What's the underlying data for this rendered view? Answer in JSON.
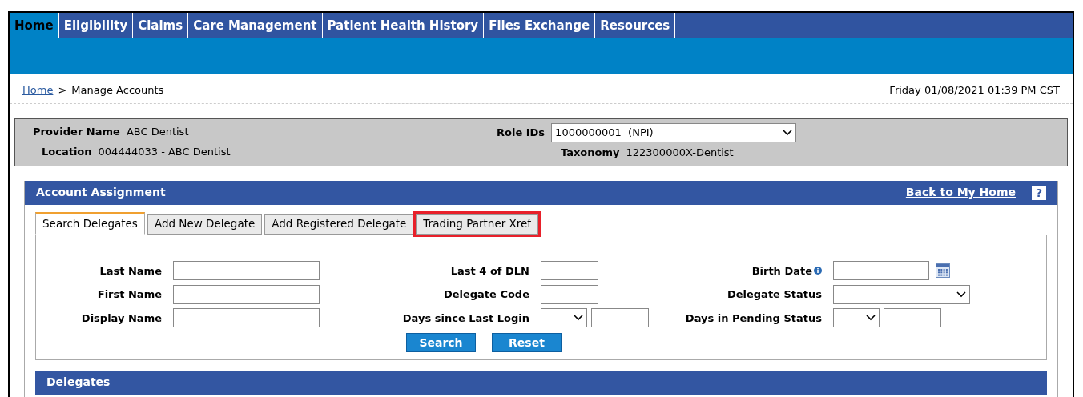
{
  "nav": [
    {
      "label": "Home",
      "selected": true
    },
    {
      "label": "Eligibility",
      "selected": false
    },
    {
      "label": "Claims",
      "selected": false
    },
    {
      "label": "Care Management",
      "selected": false
    },
    {
      "label": "Patient Health History",
      "selected": false
    },
    {
      "label": "Files Exchange",
      "selected": false
    },
    {
      "label": "Resources",
      "selected": false
    }
  ],
  "breadcrumb": {
    "link": "Home",
    "separator": ">",
    "current": "Manage Accounts"
  },
  "datetime": "Friday 01/08/2021 01:39 PM CST",
  "provider": {
    "name_label": "Provider Name",
    "name": "ABC Dentist",
    "location_label": "Location",
    "location": "004444033 - ABC Dentist",
    "role_label": "Role IDs",
    "role_value": "1000000001  (NPI)",
    "taxonomy_label": "Taxonomy",
    "taxonomy": "122300000X-Dentist"
  },
  "panel": {
    "title": "Account Assignment",
    "back_link": "Back to My Home",
    "help": "?",
    "tabs": [
      {
        "label": "Search Delegates",
        "selected": true,
        "highlighted": false
      },
      {
        "label": "Add New Delegate",
        "selected": false,
        "highlighted": false
      },
      {
        "label": "Add Registered Delegate",
        "selected": false,
        "highlighted": false
      },
      {
        "label": "Trading Partner Xref",
        "selected": false,
        "highlighted": true
      }
    ],
    "columns": [
      [
        {
          "label": "Last Name",
          "kind": "text"
        },
        {
          "label": "First Name",
          "kind": "text"
        },
        {
          "label": "Display Name",
          "kind": "text"
        }
      ],
      [
        {
          "label": "Last 4 of DLN",
          "kind": "text"
        },
        {
          "label": "Delegate Code",
          "kind": "text"
        },
        {
          "label": "Days since Last Login",
          "kind": "select_text"
        }
      ],
      [
        {
          "label": "Birth Date",
          "kind": "date",
          "info": true
        },
        {
          "label": "Delegate Status",
          "kind": "select"
        },
        {
          "label": "Days in Pending Status",
          "kind": "select_text"
        }
      ]
    ],
    "buttons": [
      "Search",
      "Reset"
    ]
  },
  "delegates": {
    "title": "Delegates"
  }
}
